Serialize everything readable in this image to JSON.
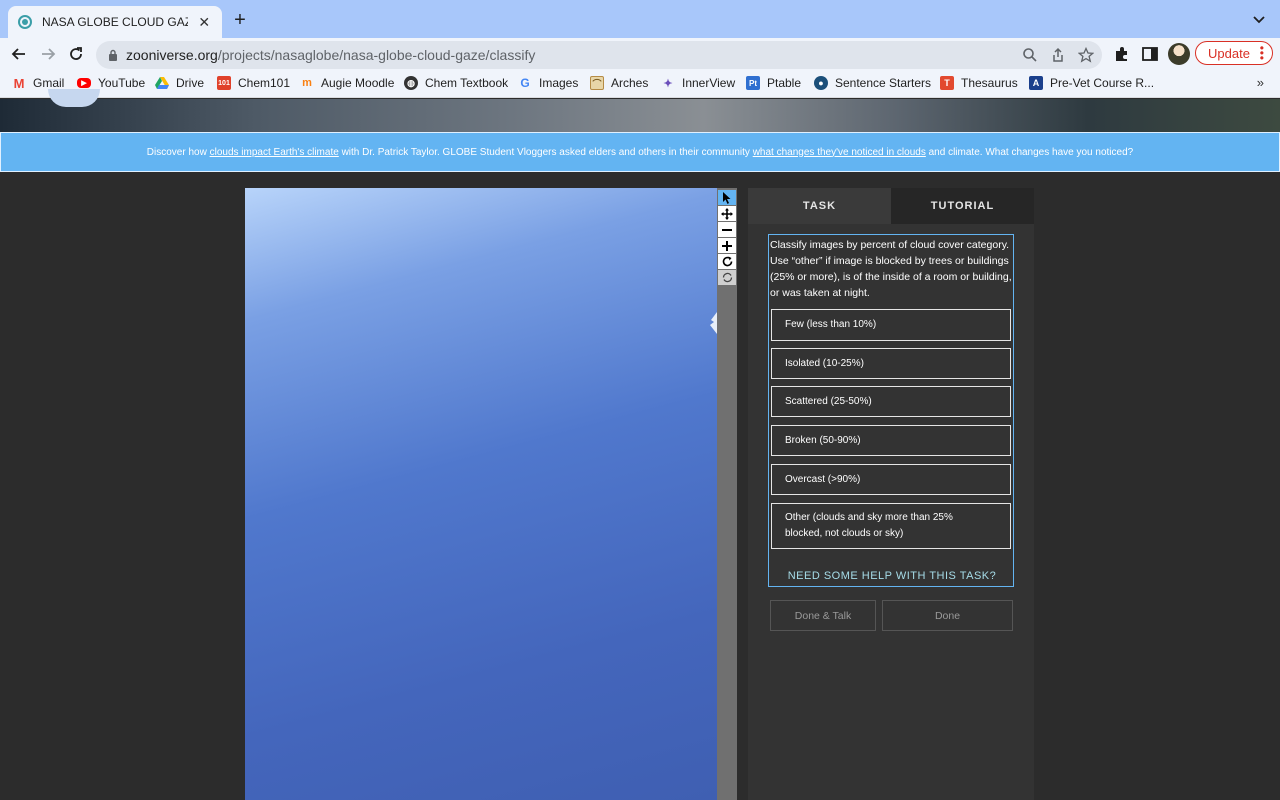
{
  "browser": {
    "tab_title": "NASA GLOBE CLOUD GAZE » Cl",
    "url_host": "zooniverse.org",
    "url_path": "/projects/nasaglobe/nasa-globe-cloud-gaze/classify",
    "update_label": "Update"
  },
  "bookmarks": [
    {
      "label": "Gmail",
      "icon": "gmail-icon",
      "color": "#ea4335"
    },
    {
      "label": "YouTube",
      "icon": "youtube-icon",
      "color": "#ff0000"
    },
    {
      "label": "Drive",
      "icon": "drive-icon",
      "color": "#1fa463"
    },
    {
      "label": "Chem101",
      "icon": "chem101-icon",
      "color": "#e0412b"
    },
    {
      "label": "Augie Moodle",
      "icon": "moodle-icon",
      "color": "#f98012"
    },
    {
      "label": "Chem Textbook",
      "icon": "globe-icon",
      "color": "#333333"
    },
    {
      "label": "Images",
      "icon": "google-icon",
      "color": "#4285f4"
    },
    {
      "label": "Arches",
      "icon": "arches-icon",
      "color": "#b58b45"
    },
    {
      "label": "InnerView",
      "icon": "innerview-icon",
      "color": "#6b4fbb"
    },
    {
      "label": "Ptable",
      "icon": "ptable-icon",
      "color": "#2f6fd0"
    },
    {
      "label": "Sentence Starters",
      "icon": "sentence-icon",
      "color": "#1b4f7a"
    },
    {
      "label": "Thesaurus",
      "icon": "thesaurus-icon",
      "color": "#e2492f"
    },
    {
      "label": "Pre-Vet Course R...",
      "icon": "augustana-icon",
      "color": "#1a3f8c"
    }
  ],
  "announcement": {
    "part1": "Discover how ",
    "link1": "clouds impact Earth's climate",
    "part2": " with Dr. Patrick Taylor. GLOBE Student Vloggers asked elders and others in their community ",
    "link2": "what changes they've noticed in clouds",
    "part3": " and climate. What changes have you noticed?"
  },
  "panel": {
    "tab_task": "TASK",
    "tab_tutorial": "TUTORIAL",
    "instruction": "Classify images by percent of cloud cover category. Use “other” if image is blocked by trees or buildings (25% or more), is of the inside of a room or building, or was taken at night.",
    "answers": [
      "Few (less than 10%)",
      "Isolated (10-25%)",
      "Scattered (25-50%)",
      "Broken (50-90%)",
      "Overcast (>90%)",
      "Other (clouds and sky more than 25% blocked, not clouds or sky)"
    ],
    "help": "NEED SOME HELP WITH THIS TASK?",
    "done_talk": "Done & Talk",
    "done": "Done"
  },
  "colors": {
    "accent": "#63b4f2",
    "panel_bg": "#333333",
    "page_bg": "#2c2c2c"
  }
}
